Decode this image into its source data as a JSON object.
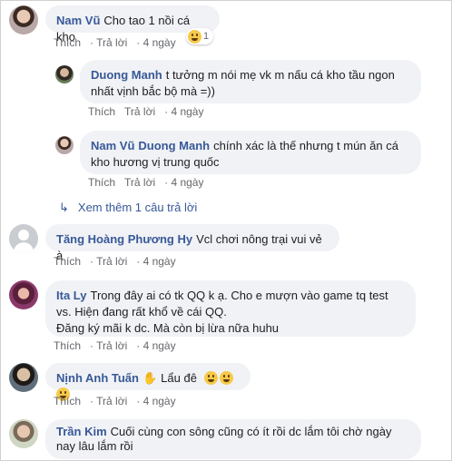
{
  "actions": {
    "like": "Thích",
    "reply": "Trả lời",
    "dot": "·"
  },
  "comments": [
    {
      "author": "Nam Vũ",
      "text": "Cho tao 1 nồi cá kho",
      "time": "4 ngày",
      "reaction_count": "1"
    },
    {
      "author": "Duong Manh",
      "text": "t tưởng m nói mẹ vk m nấu cá kho tầu ngon nhất vịnh bắc bộ mà =))",
      "time": "4 ngày"
    },
    {
      "author": "Nam Vũ",
      "mention": "Duong Manh",
      "text": "chính xác là thế nhưng t mún ăn cá kho hương vị trung quốc",
      "time": "4 ngày"
    },
    {
      "author": "Tăng Hoàng Phương Hy",
      "text": "Vcl chơi nông trại vui vẻ à",
      "time": "4 ngày"
    },
    {
      "author": "Ita Ly",
      "text": "Trong đây ai có tk QQ k ạ. Cho e mượn vào game tq test vs. Hiện đang rất khổ về cái QQ.",
      "text2": "Đăng ký mãi k dc. Mà còn bị lừa nữa huhu",
      "time": "4 ngày"
    },
    {
      "author": "Nịnh Anh Tuấn",
      "text": "Lẩu đê",
      "time": "4 ngày"
    },
    {
      "author": "Trần Kim",
      "text": "Cuối cùng con sông cũng có ít rồi dc lắm tôi chờ ngày nay lâu lắm rồi"
    }
  ],
  "view_more": "Xem thêm 1 câu trả lời",
  "colors": {
    "link": "#385898",
    "bubble": "#f0f2f5",
    "meta": "#65676b"
  }
}
